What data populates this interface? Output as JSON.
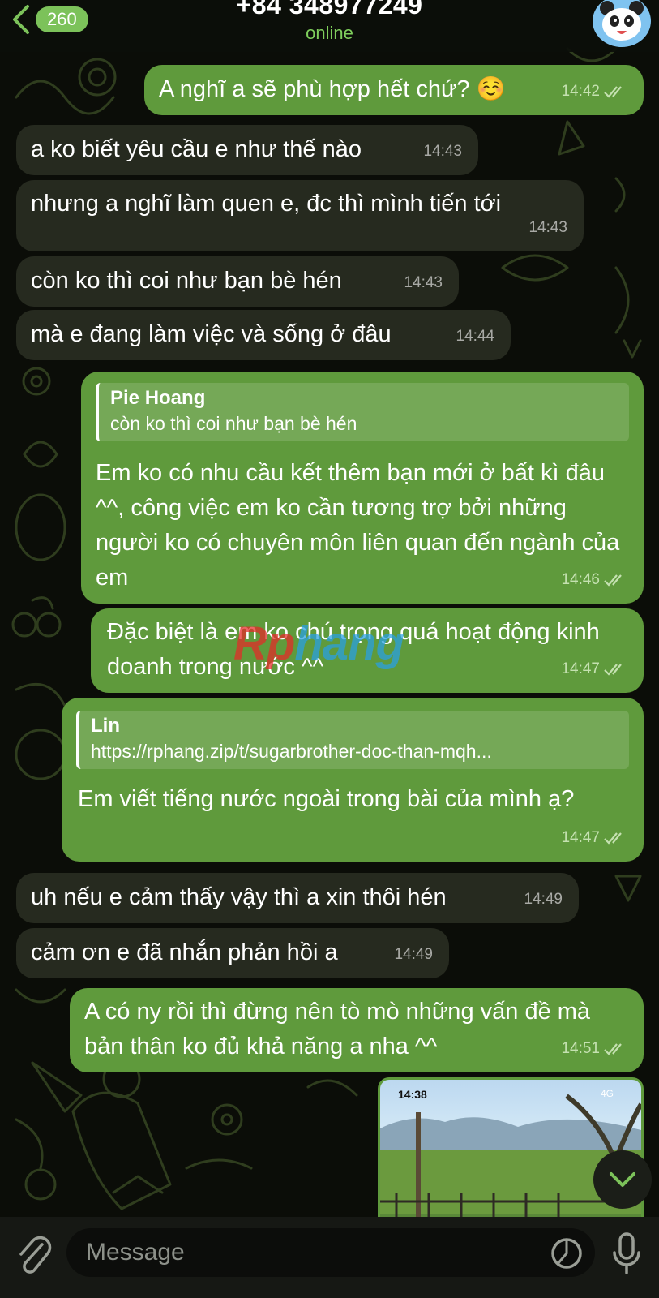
{
  "header": {
    "back_count": "260",
    "title": "+84 348977249",
    "status": "online"
  },
  "messages": [
    {
      "dir": "out",
      "text": "A nghĩ a sẽ phù hợp hết chứ? ☺️",
      "time": "14:42",
      "read": true
    },
    {
      "dir": "in",
      "text": "a ko biết yêu cầu e như thế nào",
      "time": "14:43"
    },
    {
      "dir": "in",
      "text": "nhưng a nghĩ làm quen e, đc thì mình tiến tới",
      "time": "14:43"
    },
    {
      "dir": "in",
      "text": "còn ko thì coi như bạn bè hén",
      "time": "14:43"
    },
    {
      "dir": "in",
      "text": "mà e đang làm việc và sống ở đâu",
      "time": "14:44"
    },
    {
      "dir": "out",
      "reply_name": "Pie Hoang",
      "reply_text": "còn ko thì coi như bạn bè hén",
      "text": "Em ko có nhu cầu kết thêm bạn mới ở bất kì đâu ^^, công việc em ko cần tương trợ bởi những người ko có chuyên môn liên quan đến ngành của em",
      "time": "14:46",
      "read": true
    },
    {
      "dir": "out",
      "text": "Đặc biệt là em ko chú trọng quá hoạt động kinh doanh trong nước ^^",
      "time": "14:47",
      "read": true
    },
    {
      "dir": "out",
      "reply_name": "Lin",
      "reply_text": "https://rphang.zip/t/sugarbrother-doc-than-mqh...",
      "text": "Em viết tiếng nước ngoài trong bài của mình ạ?",
      "time": "14:47",
      "read": true
    },
    {
      "dir": "in",
      "text": "uh nếu e cảm thấy vậy thì a xin thôi hén",
      "time": "14:49"
    },
    {
      "dir": "in",
      "text": "cảm ơn e đã nhắn phản hồi a",
      "time": "14:49"
    },
    {
      "dir": "out",
      "text": "A có ny rồi thì đừng nên tò mò những vấn đề mà bản thân ko đủ khả năng a nha ^^",
      "time": "14:51",
      "read": true
    }
  ],
  "media": {
    "status_time": "14:38",
    "network": "4G"
  },
  "watermark": {
    "part1": "Rp",
    "part2": "hang"
  },
  "composer": {
    "placeholder": "Message"
  },
  "colors": {
    "accent": "#7cc25a",
    "out_bubble": "#5f9a3c",
    "in_bubble": "#262a1f"
  }
}
